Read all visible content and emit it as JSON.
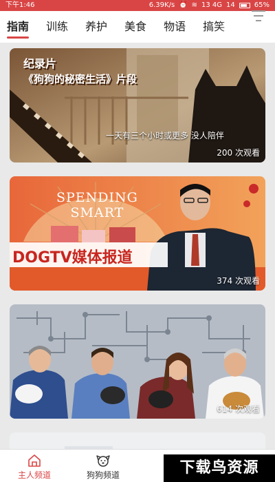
{
  "status_bar": {
    "time": "下午1:46",
    "speed": "6.39K/s",
    "network": "13 4G",
    "signal2": "14",
    "battery": "65%"
  },
  "tabs": [
    {
      "label": "指南",
      "active": true
    },
    {
      "label": "训练",
      "active": false
    },
    {
      "label": "养护",
      "active": false
    },
    {
      "label": "美食",
      "active": false
    },
    {
      "label": "物语",
      "active": false
    },
    {
      "label": "搞笑",
      "active": false
    }
  ],
  "cards": [
    {
      "caption_line1": "纪录片",
      "caption_line2": "《狗狗的秘密生活》片段",
      "subtitle": "一天有三个小时或更多  没人陪伴",
      "views": "200 次观看"
    },
    {
      "banner_line1": "SPENDING",
      "banner_line2": "SMART",
      "program_title": "DOGTV媒体报道",
      "views": "374 次观看"
    },
    {
      "views": "614 次观看"
    }
  ],
  "bottom_nav": [
    {
      "label": "主人频道",
      "icon": "home-icon",
      "active": true
    },
    {
      "label": "狗狗频道",
      "icon": "dog-face-icon",
      "active": false
    },
    {
      "label": "",
      "icon": "partial-icon",
      "active": false
    }
  ],
  "watermark": "下载鸟资源",
  "colors": {
    "accent": "#d94545",
    "tab_active_underline": "#d94545"
  }
}
